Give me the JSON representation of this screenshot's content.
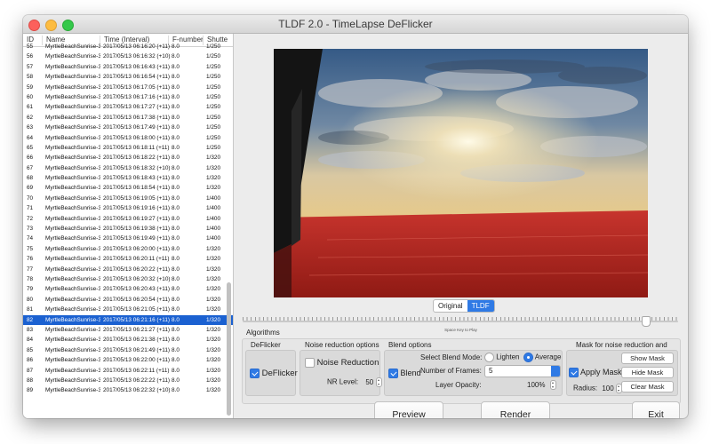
{
  "window": {
    "title": "TLDF 2.0 - TimeLapse DeFlicker"
  },
  "table": {
    "columns": [
      "ID",
      "Name",
      "Time (Interval)",
      "F-number",
      "Shutte"
    ],
    "rows": [
      {
        "id": "55",
        "name": "MyrtleBeachSunrise-3",
        "time": "2017/05/13 06:16:20 (+11)",
        "f": "8.0",
        "shutter": "1/250"
      },
      {
        "id": "56",
        "name": "MyrtleBeachSunrise-3",
        "time": "2017/05/13 06:16:32 (+10)",
        "f": "8.0",
        "shutter": "1/250"
      },
      {
        "id": "57",
        "name": "MyrtleBeachSunrise-3",
        "time": "2017/05/13 06:16:43 (+11)",
        "f": "8.0",
        "shutter": "1/250"
      },
      {
        "id": "58",
        "name": "MyrtleBeachSunrise-3",
        "time": "2017/05/13 06:16:54 (+11)",
        "f": "8.0",
        "shutter": "1/250"
      },
      {
        "id": "59",
        "name": "MyrtleBeachSunrise-3",
        "time": "2017/05/13 06:17:05 (+11)",
        "f": "8.0",
        "shutter": "1/250"
      },
      {
        "id": "60",
        "name": "MyrtleBeachSunrise-3",
        "time": "2017/05/13 06:17:16 (+11)",
        "f": "8.0",
        "shutter": "1/250"
      },
      {
        "id": "61",
        "name": "MyrtleBeachSunrise-3",
        "time": "2017/05/13 06:17:27 (+11)",
        "f": "8.0",
        "shutter": "1/250"
      },
      {
        "id": "62",
        "name": "MyrtleBeachSunrise-3",
        "time": "2017/05/13 06:17:38 (+11)",
        "f": "8.0",
        "shutter": "1/250"
      },
      {
        "id": "63",
        "name": "MyrtleBeachSunrise-3",
        "time": "2017/05/13 06:17:49 (+11)",
        "f": "8.0",
        "shutter": "1/250"
      },
      {
        "id": "64",
        "name": "MyrtleBeachSunrise-3",
        "time": "2017/05/13 06:18:00 (+11)",
        "f": "8.0",
        "shutter": "1/250"
      },
      {
        "id": "65",
        "name": "MyrtleBeachSunrise-3",
        "time": "2017/05/13 06:18:11 (+11)",
        "f": "8.0",
        "shutter": "1/250"
      },
      {
        "id": "66",
        "name": "MyrtleBeachSunrise-3",
        "time": "2017/05/13 06:18:22 (+11)",
        "f": "8.0",
        "shutter": "1/320"
      },
      {
        "id": "67",
        "name": "MyrtleBeachSunrise-3",
        "time": "2017/05/13 06:18:32 (+10)",
        "f": "8.0",
        "shutter": "1/320"
      },
      {
        "id": "68",
        "name": "MyrtleBeachSunrise-3",
        "time": "2017/05/13 06:18:43 (+11)",
        "f": "8.0",
        "shutter": "1/320"
      },
      {
        "id": "69",
        "name": "MyrtleBeachSunrise-3",
        "time": "2017/05/13 06:18:54 (+11)",
        "f": "8.0",
        "shutter": "1/320"
      },
      {
        "id": "70",
        "name": "MyrtleBeachSunrise-3",
        "time": "2017/05/13 06:19:05 (+11)",
        "f": "8.0",
        "shutter": "1/400"
      },
      {
        "id": "71",
        "name": "MyrtleBeachSunrise-3",
        "time": "2017/05/13 06:19:16 (+11)",
        "f": "8.0",
        "shutter": "1/400"
      },
      {
        "id": "72",
        "name": "MyrtleBeachSunrise-3",
        "time": "2017/05/13 06:19:27 (+11)",
        "f": "8.0",
        "shutter": "1/400"
      },
      {
        "id": "73",
        "name": "MyrtleBeachSunrise-3",
        "time": "2017/05/13 06:19:38 (+11)",
        "f": "8.0",
        "shutter": "1/400"
      },
      {
        "id": "74",
        "name": "MyrtleBeachSunrise-3",
        "time": "2017/05/13 06:19:49 (+11)",
        "f": "8.0",
        "shutter": "1/400"
      },
      {
        "id": "75",
        "name": "MyrtleBeachSunrise-3",
        "time": "2017/05/13 06:20:00 (+11)",
        "f": "8.0",
        "shutter": "1/320"
      },
      {
        "id": "76",
        "name": "MyrtleBeachSunrise-3",
        "time": "2017/05/13 06:20:11 (+11)",
        "f": "8.0",
        "shutter": "1/320"
      },
      {
        "id": "77",
        "name": "MyrtleBeachSunrise-3",
        "time": "2017/05/13 06:20:22 (+11)",
        "f": "8.0",
        "shutter": "1/320"
      },
      {
        "id": "78",
        "name": "MyrtleBeachSunrise-3",
        "time": "2017/05/13 06:20:32 (+10)",
        "f": "8.0",
        "shutter": "1/320"
      },
      {
        "id": "79",
        "name": "MyrtleBeachSunrise-3",
        "time": "2017/05/13 06:20:43 (+11)",
        "f": "8.0",
        "shutter": "1/320"
      },
      {
        "id": "80",
        "name": "MyrtleBeachSunrise-3",
        "time": "2017/05/13 06:20:54 (+11)",
        "f": "8.0",
        "shutter": "1/320"
      },
      {
        "id": "81",
        "name": "MyrtleBeachSunrise-3",
        "time": "2017/05/13 06:21:05 (+11)",
        "f": "8.0",
        "shutter": "1/320"
      },
      {
        "id": "82",
        "name": "MyrtleBeachSunrise-3",
        "time": "2017/05/13 06:21:16 (+11)",
        "f": "8.0",
        "shutter": "1/320",
        "selected": true
      },
      {
        "id": "83",
        "name": "MyrtleBeachSunrise-3",
        "time": "2017/05/13 06:21:27 (+11)",
        "f": "8.0",
        "shutter": "1/320"
      },
      {
        "id": "84",
        "name": "MyrtleBeachSunrise-3",
        "time": "2017/05/13 06:21:38 (+11)",
        "f": "8.0",
        "shutter": "1/320"
      },
      {
        "id": "85",
        "name": "MyrtleBeachSunrise-3",
        "time": "2017/05/13 06:21:49 (+11)",
        "f": "8.0",
        "shutter": "1/320"
      },
      {
        "id": "86",
        "name": "MyrtleBeachSunrise-3",
        "time": "2017/05/13 06:22:00 (+11)",
        "f": "8.0",
        "shutter": "1/320"
      },
      {
        "id": "87",
        "name": "MyrtleBeachSunrise-3",
        "time": "2017/05/13 06:22:11 (+11)",
        "f": "8.0",
        "shutter": "1/320"
      },
      {
        "id": "88",
        "name": "MyrtleBeachSunrise-3",
        "time": "2017/05/13 06:22:22 (+11)",
        "f": "8.0",
        "shutter": "1/320"
      },
      {
        "id": "89",
        "name": "MyrtleBeachSunrise-3",
        "time": "2017/05/13 06:22:32 (+10)",
        "f": "8.0",
        "shutter": "1/320"
      }
    ]
  },
  "view_toggle": {
    "original": "Original",
    "tldf": "TLDF",
    "active": "TLDF"
  },
  "timeline": {
    "hint": "Space Key to Play"
  },
  "algorithms": {
    "section_label": "Algorithms",
    "deflicker": {
      "header": "DeFlicker",
      "label": "DeFlicker",
      "checked": true
    },
    "noise": {
      "header": "Noise reduction options",
      "label": "Noise Reduction",
      "checked": false,
      "level_label": "NR Level:",
      "level": "50"
    },
    "blend": {
      "header": "Blend options",
      "label": "Blend",
      "checked": true,
      "mode_label": "Select Blend Mode:",
      "mode_lighten": "Lighten",
      "mode_average": "Average",
      "mode_selected": "Average",
      "frames_label": "Number of Frames:",
      "frames": "5",
      "opacity_label": "Layer Opacity:",
      "opacity": "100%"
    },
    "mask": {
      "header": "Mask for noise reduction and blend",
      "label": "Apply Mask",
      "checked": true,
      "show": "Show Mask",
      "hide": "Hide Mask",
      "clear": "Clear Mask",
      "radius_label": "Radius:",
      "radius": "100"
    }
  },
  "actions": {
    "preview": "Preview",
    "render": "Render",
    "exit": "Exit"
  },
  "colors": {
    "accent": "#2f7ae5",
    "selection": "#1b61d1",
    "mask_overlay": "#c0201c"
  }
}
